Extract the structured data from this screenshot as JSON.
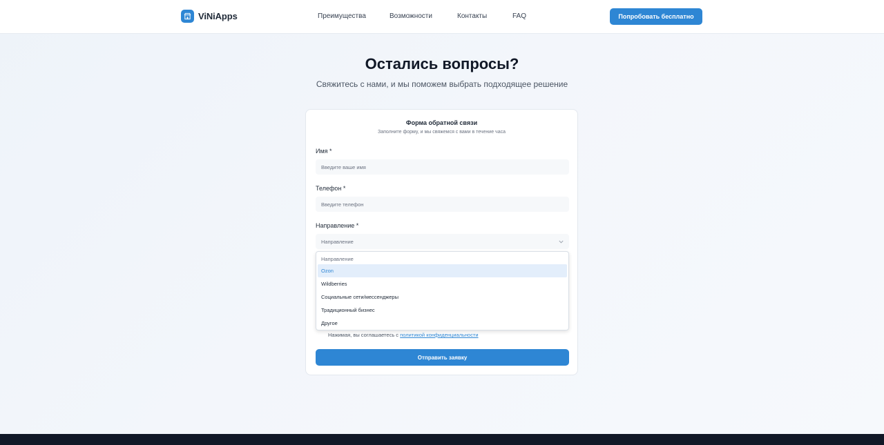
{
  "header": {
    "logo_text": "ViNiApps",
    "nav": [
      {
        "label": "Преимущества"
      },
      {
        "label": "Возможности"
      },
      {
        "label": "Контакты"
      },
      {
        "label": "FAQ"
      }
    ],
    "cta_label": "Попробовать бесплатно"
  },
  "hero": {
    "title": "Остались вопросы?",
    "subtitle": "Свяжитесь с нами, и мы поможем выбрать подходящее решение"
  },
  "form": {
    "title": "Форма обратной связи",
    "subtitle": "Заполните форму, и мы свяжемся с вами в течение часа",
    "name_label": "Имя *",
    "name_placeholder": "Введите ваше имя",
    "phone_label": "Телефон *",
    "phone_placeholder": "Введите телефон",
    "direction_label": "Направление *",
    "direction_value": "Направление",
    "consent_text": "Нажимая, вы соглашаетесь с ",
    "consent_link": "политикой конфиденциальности",
    "submit_label": "Отправить заявку"
  },
  "dropdown": {
    "options": [
      {
        "label": "Направление"
      },
      {
        "label": "Ozon"
      },
      {
        "label": "Wildberries"
      },
      {
        "label": "Социальные сети/мессенджеры"
      },
      {
        "label": "Традиционный бизнес"
      },
      {
        "label": "Другое"
      }
    ],
    "highlighted": "Ozon"
  },
  "colors": {
    "accent": "#2e86d4",
    "footer": "#111827"
  }
}
